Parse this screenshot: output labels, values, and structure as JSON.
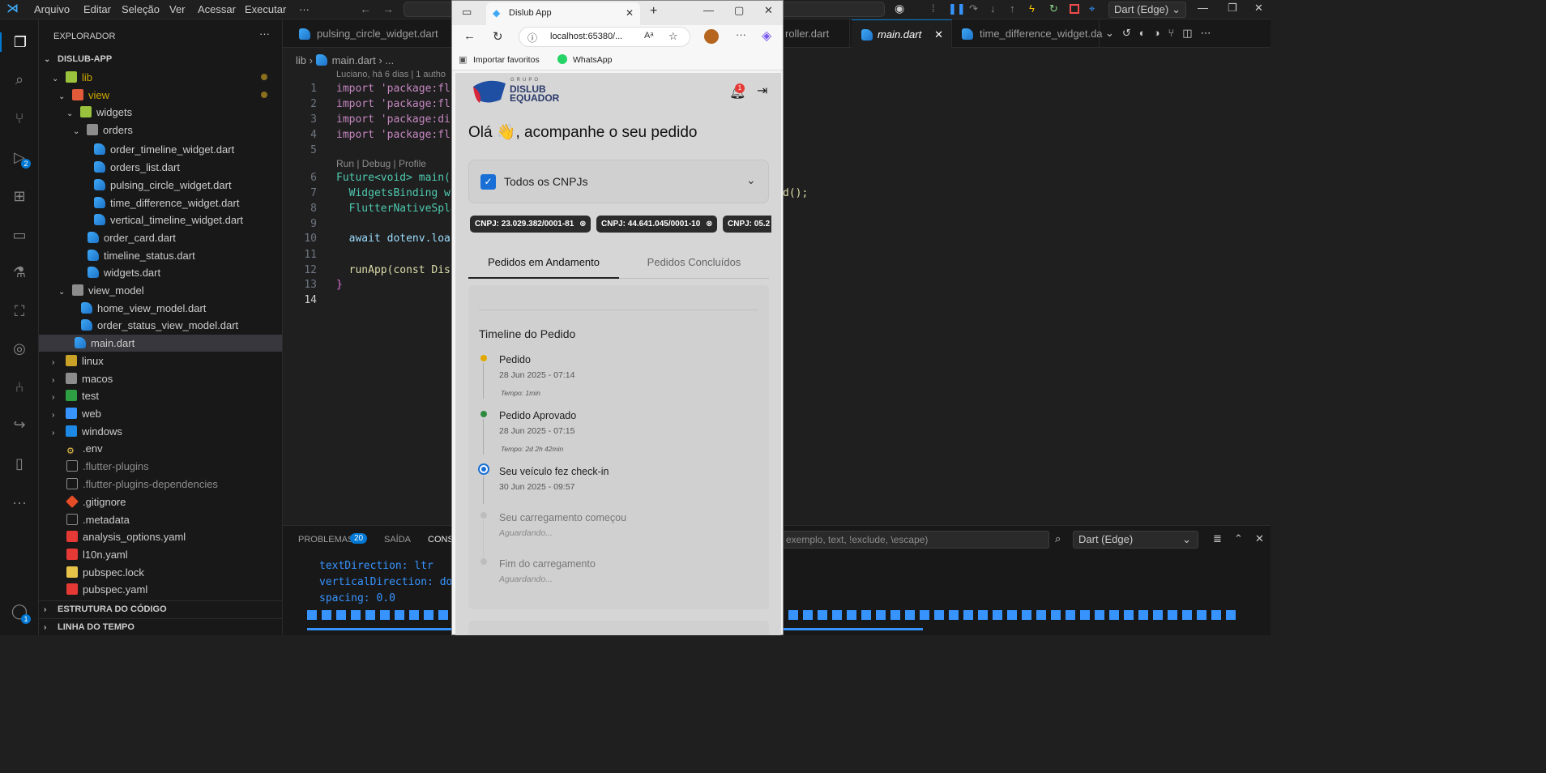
{
  "menu": [
    "Arquivo",
    "Editar",
    "Seleção",
    "Ver",
    "Acessar",
    "Executar",
    "···"
  ],
  "debug_config": "Dart (Edge)",
  "explorer": {
    "title": "EXPLORADOR",
    "project": "DISLUB-APP",
    "items": [
      "lib",
      "view",
      "widgets",
      "orders",
      "order_timeline_widget.dart",
      "orders_list.dart",
      "pulsing_circle_widget.dart",
      "time_difference_widget.dart",
      "vertical_timeline_widget.dart",
      "order_card.dart",
      "timeline_status.dart",
      "widgets.dart",
      "view_model",
      "home_view_model.dart",
      "order_status_view_model.dart",
      "main.dart",
      "linux",
      "macos",
      "test",
      "web",
      "windows",
      ".env",
      ".flutter-plugins",
      ".flutter-plugins-dependencies",
      ".gitignore",
      ".metadata",
      "analysis_options.yaml",
      "l10n.yaml",
      "pubspec.lock",
      "pubspec.yaml"
    ],
    "outline": "ESTRUTURA DO CÓDIGO",
    "timeline": "LINHA DO TEMPO"
  },
  "activity_badges": {
    "debug": "2",
    "account": "1"
  },
  "editor": {
    "tabs": [
      "pulsing_circle_widget.dart",
      "roller.dart",
      "main.dart",
      "time_difference_widget.da"
    ],
    "breadcrumb_lib": "lib",
    "breadcrumb_file": "main.dart",
    "breadcrumb_more": "...",
    "blame": "Luciano, há 6 dias | 1 autho",
    "codelens": "Run | Debug | Profile",
    "line_numbers": [
      "1",
      "2",
      "3",
      "4",
      "5",
      "6",
      "7",
      "8",
      "9",
      "10",
      "11",
      "12",
      "13",
      "14"
    ],
    "code": {
      "l1": "import 'package:flu",
      "l2": "import 'package:flu",
      "l3": "import 'package:dis",
      "l4": "import 'package:flu",
      "l6": "Future<void> main()",
      "l7": "  WidgetsBinding wi",
      "l7_tail": "d();",
      "l8": "  FlutterNativeSpla",
      "l10": "  await dotenv.loa",
      "l12": "  runApp(const Disl",
      "l13": "}"
    }
  },
  "panel": {
    "tab_problems": "PROBLEMAS",
    "problems_count": "20",
    "tab_output": "SAÍDA",
    "tab_console": "CONS",
    "filter_placeholder": "exemplo, text, !exclude, \\escape)",
    "console_config": "Dart (Edge)",
    "lines": [
      "textDirection: ltr",
      "verticalDirection: dow",
      "spacing: 0.0"
    ]
  },
  "browser": {
    "tab_title": "Dislub App",
    "url": "localhost:65380/...",
    "bookmarks": [
      "Importar favoritos",
      "WhatsApp"
    ]
  },
  "app": {
    "logo_small": "GRUPO",
    "logo_line1": "DISLUB",
    "logo_line2": "EQUADOR",
    "notification_count": "1",
    "greeting": "Olá 👋, acompanhe o seu pedido",
    "cnpj_selector": "Todos os CNPJs",
    "chips": [
      "CNPJ: 23.029.382/0001-81",
      "CNPJ: 44.641.045/0001-10",
      "CNPJ: 05.2"
    ],
    "tabs": [
      "Pedidos em Andamento",
      "Pedidos Concluídos"
    ],
    "timeline_title": "Timeline do Pedido",
    "steps": [
      {
        "label": "Pedido",
        "date": "28 Jun 2025 - 07:14",
        "duration": "Tempo: 1min",
        "status": "done",
        "color": "#e0a800"
      },
      {
        "label": "Pedido Aprovado",
        "date": "28 Jun 2025 - 07:15",
        "duration": "Tempo: 2d 2h 42min",
        "status": "done",
        "color": "#2e8b3e"
      },
      {
        "label": "Seu veículo fez check-in",
        "date": "30 Jun 2025 - 09:57",
        "status": "current",
        "color": "#1a6fd6"
      },
      {
        "label": "Seu carregamento começou",
        "date": "Aguardando...",
        "status": "pending"
      },
      {
        "label": "Fim do carregamento",
        "date": "Aguardando...",
        "status": "pending"
      }
    ]
  },
  "colors": {
    "accent": "#0078d4",
    "chip_bg": "#2b2b2b",
    "app_bg": "#d6d6d6"
  }
}
